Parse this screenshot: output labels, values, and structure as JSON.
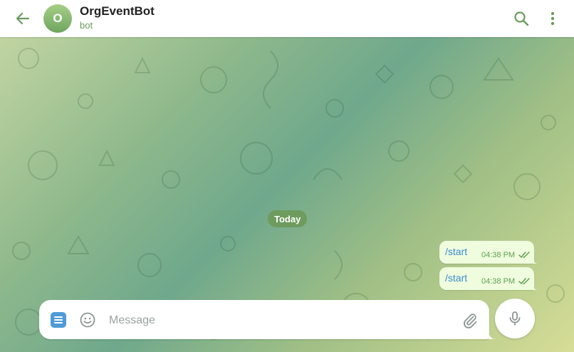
{
  "header": {
    "back_icon": "arrow-left-icon",
    "avatar_letter": "O",
    "title": "OrgEventBot",
    "subtitle": "bot",
    "search_icon": "search-icon",
    "more_icon": "more-vertical-icon"
  },
  "chat": {
    "date_label": "Today",
    "messages": [
      {
        "text": "/start",
        "time": "04:38 PM",
        "status": "read"
      },
      {
        "text": "/start",
        "time": "04:38 PM",
        "status": "read"
      }
    ]
  },
  "composer": {
    "placeholder": "Message",
    "value": "",
    "menu_icon": "bot-menu-icon",
    "emoji_icon": "emoji-icon",
    "attach_icon": "paperclip-icon",
    "mic_icon": "microphone-icon"
  },
  "colors": {
    "accent": "#6a9a5d",
    "bubble_out": "#effdde",
    "link": "#3b8ad3",
    "menu_button": "#4f9bd6"
  }
}
